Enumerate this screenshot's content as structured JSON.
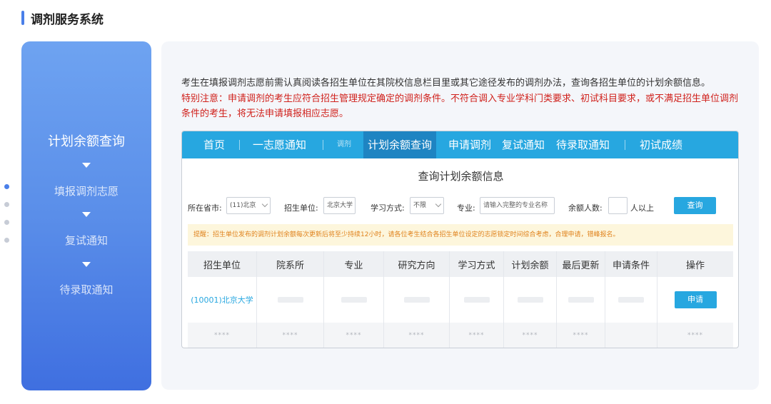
{
  "page_title": "调剂服务系统",
  "steps": [
    {
      "label": "计划余额查询",
      "active": true
    },
    {
      "label": "填报调剂志愿",
      "active": false
    },
    {
      "label": "复试通知",
      "active": false
    },
    {
      "label": "待录取通知",
      "active": false
    }
  ],
  "intro_text": "考生在填报调剂志愿前需认真阅读各招生单位在其院校信息栏目里或其它途径发布的调剂办法，查询各招生单位的计划余额信息。",
  "notice_text": "特别注意：申请调剂的考生应符合招生管理规定确定的调剂条件。不符合调入专业学科门类要求、初试科目要求，或不满足招生单位调剂条件的考生，将无法申请填报相应志愿。",
  "nav": {
    "home": "首页",
    "first_choice": "一志愿通知",
    "adjust_small": "调剂",
    "plan_query": "计划余额查询",
    "apply": "申请调剂",
    "retest": "复试通知",
    "admit": "待录取通知",
    "score": "初试成绩"
  },
  "query_title": "查询计划余额信息",
  "form": {
    "province_label": "所在省市:",
    "province_value": "(11)北京",
    "unit_label": "招生单位:",
    "unit_value": "北京大学",
    "mode_label": "学习方式:",
    "mode_value": "不限",
    "major_label": "专业:",
    "major_placeholder": "请输入完整的专业名称",
    "count_label": "余额人数:",
    "count_value": "",
    "count_suffix": "人以上",
    "query_button": "查询"
  },
  "tip_text": "提醒：招生单位发布的调剂计划余额每次更新后将至少持续12小时，请各位考生结合各招生单位设定的志愿锁定时间综合考虑，合理申请，错峰报名。",
  "table": {
    "headers": [
      "招生单位",
      "院系所",
      "专业",
      "研究方向",
      "学习方式",
      "计划余额",
      "最后更新",
      "申请条件",
      "操作"
    ],
    "row1_unit": "(10001)北京大学",
    "row1_action": "申请",
    "row2_cells": [
      "****",
      "****",
      "****",
      "****",
      "****",
      "****",
      "****",
      "",
      "****"
    ]
  },
  "colors": {
    "accent": "#4a7fe9",
    "nav_bg": "#27a7e0",
    "notice_red": "#d0211c",
    "tip_orange": "#e0831d"
  }
}
